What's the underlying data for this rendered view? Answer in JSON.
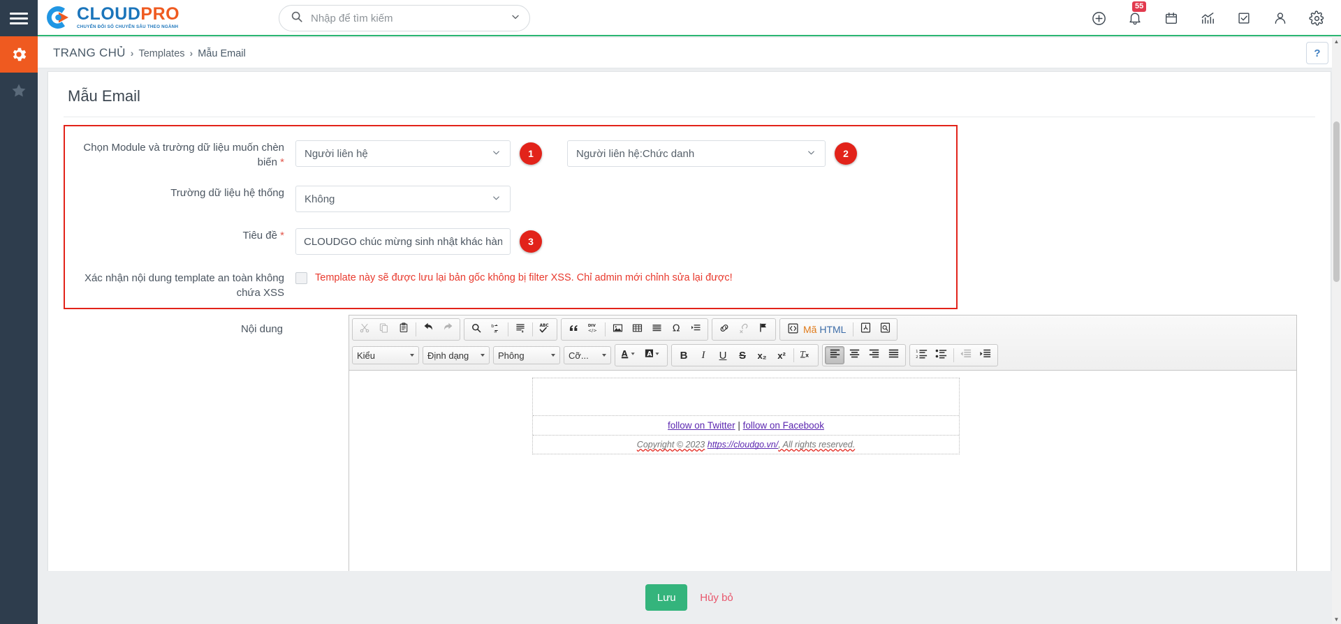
{
  "rail": {
    "menu_icon": "hamburger-icon",
    "items": [
      {
        "icon": "gear-icon",
        "name": "settings",
        "active": true
      },
      {
        "icon": "star-icon",
        "name": "favorites",
        "active": false
      }
    ]
  },
  "brand": {
    "name_main": "CLOUD",
    "name_accent": "PRO",
    "tagline": "CHUYỂN ĐỔI SỐ CHUYÊN SÂU THEO NGÀNH",
    "color_primary": "#1b75bb",
    "color_accent": "#ef5a20"
  },
  "search": {
    "placeholder": "Nhập để tìm kiếm",
    "value": "",
    "icon": "search-icon",
    "caret_icon": "chevron-down-icon"
  },
  "topicons": [
    {
      "name": "add-new",
      "icon": "plus-circle-icon",
      "badge": null
    },
    {
      "name": "notifications",
      "icon": "bell-icon",
      "badge": "55"
    },
    {
      "name": "calendar",
      "icon": "calendar-icon",
      "badge": null
    },
    {
      "name": "reports",
      "icon": "chart-icon",
      "badge": null
    },
    {
      "name": "tasks",
      "icon": "checkbox-icon",
      "badge": null
    },
    {
      "name": "account",
      "icon": "person-icon",
      "badge": null
    },
    {
      "name": "settings",
      "icon": "gear-icon",
      "badge": null
    }
  ],
  "breadcrumb": {
    "home": "TRANG CHỦ",
    "sep": "›",
    "items": [
      "Templates",
      "Mẫu Email"
    ],
    "help_label": "?"
  },
  "page": {
    "title": "Mẫu Email"
  },
  "form": {
    "module_field": {
      "label": "Chọn Module và trường dữ liệu muốn chèn biến",
      "required_mark": "*",
      "module_value": "Người liên hệ",
      "field_value": "Người liên hệ:Chức danh",
      "badge_module": "1",
      "badge_field": "2"
    },
    "system_field": {
      "label": "Trường dữ liệu hệ thống",
      "value": "Không"
    },
    "subject": {
      "label": "Tiêu đề",
      "required_mark": "*",
      "value": "CLOUDGO chúc mừng sinh nhật khác hàng %",
      "badge": "3"
    },
    "xss": {
      "label": "Xác nhận nội dung template an toàn không chứa XSS",
      "checked": false,
      "note": "Template này sẽ được lưu lại bản gốc không bị filter XSS. Chỉ admin mới chỉnh sửa lại được!",
      "note_color": "#e8392d"
    },
    "content": {
      "label": "Nội dung"
    },
    "highlight_color": "#e2231a"
  },
  "editor": {
    "toolbar_row1": [
      {
        "group": [
          {
            "name": "cut",
            "icon": "scissors-icon",
            "enabled": false
          },
          {
            "name": "copy",
            "icon": "copy-icon",
            "enabled": false
          },
          {
            "name": "paste",
            "icon": "clipboard-icon",
            "enabled": true
          },
          {
            "sep": true
          },
          {
            "name": "undo",
            "icon": "undo-arrow-icon",
            "enabled": true
          },
          {
            "name": "redo",
            "icon": "redo-arrow-icon",
            "enabled": false
          }
        ]
      },
      {
        "group": [
          {
            "name": "find",
            "icon": "magnifier-icon",
            "enabled": true
          },
          {
            "name": "replace",
            "icon": "find-replace-icon",
            "enabled": true
          },
          {
            "sep": true
          },
          {
            "name": "select-all",
            "icon": "select-all-icon",
            "enabled": true
          },
          {
            "sep": true
          },
          {
            "name": "spellcheck",
            "icon": "abc-check-icon",
            "enabled": true
          }
        ]
      },
      {
        "group": [
          {
            "name": "blockquote",
            "icon": "quote-icon",
            "enabled": true
          },
          {
            "name": "create-div",
            "icon": "div-container-icon",
            "enabled": true
          },
          {
            "sep": true
          },
          {
            "name": "image",
            "icon": "image-icon",
            "enabled": true
          },
          {
            "name": "table",
            "icon": "table-icon",
            "enabled": true
          },
          {
            "name": "horizontal-rule",
            "icon": "horizontal-rule-icon",
            "enabled": true
          },
          {
            "name": "special-character",
            "icon": "omega-icon",
            "enabled": true
          },
          {
            "name": "page-break",
            "icon": "page-break-icon",
            "enabled": true
          }
        ]
      },
      {
        "group": [
          {
            "name": "link",
            "icon": "link-icon",
            "enabled": true
          },
          {
            "name": "unlink",
            "icon": "unlink-icon",
            "enabled": false
          },
          {
            "name": "anchor",
            "icon": "flag-icon",
            "enabled": true
          }
        ]
      },
      {
        "group": [
          {
            "name": "source",
            "icon": "source-code-icon",
            "label": "Mã HTML",
            "enabled": true
          },
          {
            "sep": true
          },
          {
            "name": "templates",
            "icon": "templates-icon",
            "enabled": true
          },
          {
            "name": "preview",
            "icon": "preview-icon",
            "enabled": true
          }
        ]
      }
    ],
    "combos": [
      {
        "name": "styles",
        "label": "Kiểu"
      },
      {
        "name": "format",
        "label": "Định dạng"
      },
      {
        "name": "font",
        "label": "Phông"
      },
      {
        "name": "size",
        "label": "Cỡ..."
      }
    ],
    "color_buttons": [
      {
        "name": "text-color",
        "icon": "text-color-icon"
      },
      {
        "name": "background-color",
        "icon": "background-color-icon"
      }
    ],
    "toolbar_row2": [
      {
        "group": [
          {
            "name": "bold",
            "icon": "bold-icon",
            "glyph": "B",
            "enabled": true
          },
          {
            "name": "italic",
            "icon": "italic-icon",
            "glyph": "I",
            "enabled": true
          },
          {
            "name": "underline",
            "icon": "underline-icon",
            "glyph": "U",
            "enabled": true
          },
          {
            "name": "strikethrough",
            "icon": "strikethrough-icon",
            "glyph": "S",
            "enabled": true
          },
          {
            "name": "subscript",
            "icon": "subscript-icon",
            "glyph": "x₂",
            "enabled": true
          },
          {
            "name": "superscript",
            "icon": "superscript-icon",
            "glyph": "x²",
            "enabled": true
          },
          {
            "sep": true
          },
          {
            "name": "remove-format",
            "icon": "remove-format-icon",
            "glyph": "Tx",
            "enabled": true
          }
        ]
      },
      {
        "group": [
          {
            "name": "align-left",
            "icon": "align-left-icon",
            "enabled": true,
            "active": true
          },
          {
            "name": "align-center",
            "icon": "align-center-icon",
            "enabled": true
          },
          {
            "name": "align-right",
            "icon": "align-right-icon",
            "enabled": true
          },
          {
            "name": "align-justify",
            "icon": "align-justify-icon",
            "enabled": true
          }
        ]
      },
      {
        "group": [
          {
            "name": "numbered-list",
            "icon": "numbered-list-icon",
            "enabled": true
          },
          {
            "name": "bulleted-list",
            "icon": "bulleted-list-icon",
            "enabled": true
          },
          {
            "sep": true
          },
          {
            "name": "outdent",
            "icon": "outdent-icon",
            "enabled": false
          },
          {
            "name": "indent",
            "icon": "indent-icon",
            "enabled": true
          }
        ]
      }
    ],
    "content_preview": {
      "social_twitter": "follow on Twitter",
      "social_sep": "|",
      "social_facebook": "follow on Facebook",
      "copyright_prefix": "Copyright © 2023",
      "copyright_link": "https://cloudgo.vn/",
      "copyright_suffix": ", All rights reserved."
    }
  },
  "footer": {
    "save_label": "Lưu",
    "cancel_label": "Hủy bỏ",
    "save_color": "#34b47c",
    "cancel_color": "#e8556b"
  }
}
